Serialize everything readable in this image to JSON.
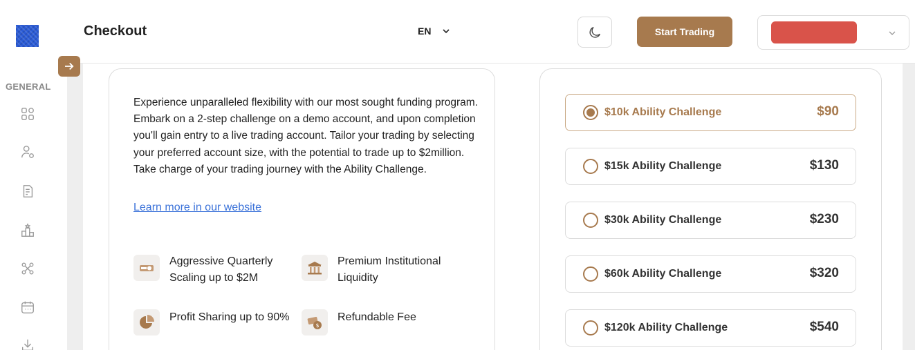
{
  "header": {
    "title": "Checkout",
    "language": "EN",
    "start_trading_label": "Start Trading"
  },
  "sidebar": {
    "heading": "GENERAL",
    "items": [
      {
        "icon": "dashboard-icon"
      },
      {
        "icon": "user-icon"
      },
      {
        "icon": "document-icon"
      },
      {
        "icon": "leaderboard-icon"
      },
      {
        "icon": "network-icon"
      },
      {
        "icon": "calendar-icon"
      },
      {
        "icon": "download-icon"
      }
    ]
  },
  "info": {
    "description": "Experience unparalleled flexibility with our most sought funding program. Embark on a 2-step challenge on a demo account, and upon completion you'll gain entry to a live trading account. Tailor your trading by selecting your preferred account size, with the potential to trade up to $2million. Take charge of your trading journey with the Ability Challenge.",
    "learn_more": "Learn more in our website",
    "features": [
      {
        "label": "Aggressive Quarterly Scaling up to $2M",
        "icon": "scaling-icon"
      },
      {
        "label": "Premium Institutional Liquidity",
        "icon": "bank-icon"
      },
      {
        "label": "Profit Sharing up to 90%",
        "icon": "pie-chart-icon"
      },
      {
        "label": "Refundable Fee",
        "icon": "money-icon"
      }
    ]
  },
  "plans": [
    {
      "name": "$10k Ability Challenge",
      "price": "$90",
      "selected": true
    },
    {
      "name": "$15k Ability Challenge",
      "price": "$130",
      "selected": false
    },
    {
      "name": "$30k Ability Challenge",
      "price": "$230",
      "selected": false
    },
    {
      "name": "$60k Ability Challenge",
      "price": "$320",
      "selected": false
    },
    {
      "name": "$120k Ability Challenge",
      "price": "$540",
      "selected": false
    }
  ],
  "colors": {
    "accent": "#a77a4e",
    "link": "#3b72d9",
    "redacted": "#d9534a"
  }
}
